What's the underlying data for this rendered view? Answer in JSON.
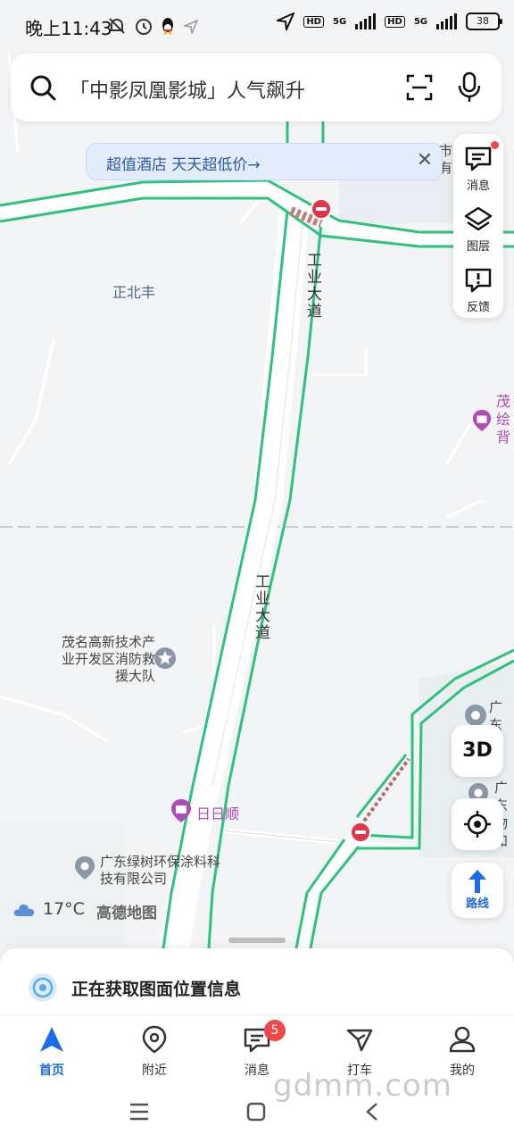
{
  "status": {
    "time": "晚上11:43",
    "net1": "5G",
    "net2": "5G",
    "hd1": "HD",
    "hd2": "HD",
    "battery": "38"
  },
  "search": {
    "placeholder": "「中影凤凰影城」人气飙升"
  },
  "promo": {
    "text": "超值酒店 天天超低价→",
    "close": "✕"
  },
  "tools": {
    "messages": "消息",
    "layers": "图层",
    "feedback": "反馈"
  },
  "map": {
    "labels": {
      "zhengbeifeng": "正北丰",
      "road1": "工业大道",
      "road2": "工业大道",
      "fire_station": "茂名高新技术产业开发区消防救援大队",
      "ririshun": "日日顺",
      "lvshu": "广东绿树环保涂料科技有限公司",
      "mao_edge": "茂绘背",
      "shi_edge": "市有",
      "guangdong_edge1": "广东料有",
      "guangdong_edge2": "广东物和"
    },
    "buttons": {
      "three_d": "3D",
      "route": "路线"
    }
  },
  "weather": {
    "temp": "17°C",
    "brand": "高德地图"
  },
  "sheet": {
    "location_status": "正在获取图面位置信息"
  },
  "nav": {
    "home": "首页",
    "nearby": "附近",
    "messages": "消息",
    "taxi": "打车",
    "me": "我的",
    "badge": "5"
  },
  "watermark": "gdmm.com",
  "colors": {
    "accent": "#1c6be8",
    "road_green": "#2ec27e",
    "badge_red": "#f04848",
    "poi_purple": "#b14bb7"
  }
}
